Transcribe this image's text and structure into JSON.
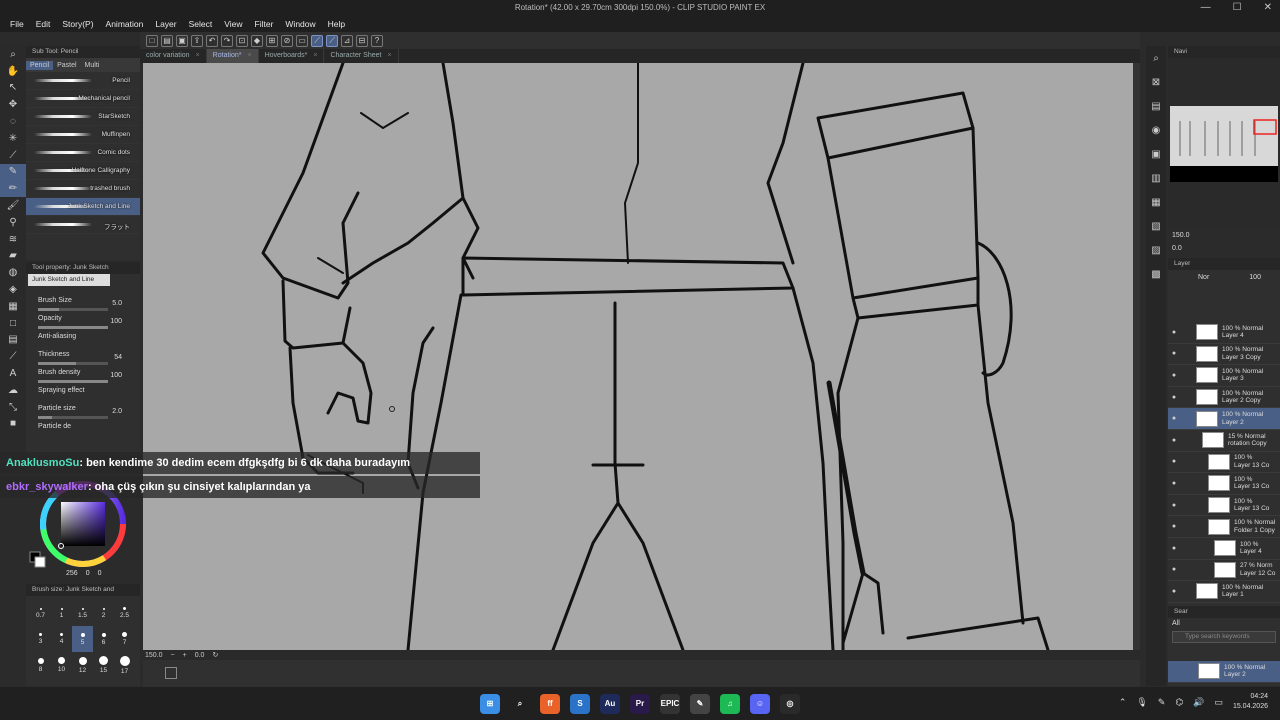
{
  "window": {
    "title": "Rotation* (42.00 x 29.70cm 300dpi 150.0%) - CLIP STUDIO PAINT EX",
    "controls": [
      "—",
      "☐",
      "✕"
    ]
  },
  "menu": [
    "File",
    "Edit",
    "Story(P)",
    "Animation",
    "Layer",
    "Select",
    "View",
    "Filter",
    "Window",
    "Help"
  ],
  "doc_tabs": [
    {
      "label": "color variation",
      "active": false
    },
    {
      "label": "Rotation*",
      "active": true
    },
    {
      "label": "Hoverboards*",
      "active": false
    },
    {
      "label": "Character Sheet",
      "active": false
    }
  ],
  "subtool": {
    "header": "Sub Tool: Pencil",
    "tabs": [
      "Pencil",
      "Pastel",
      "Multi"
    ],
    "brushes": [
      {
        "label": "Pencil",
        "selected": false
      },
      {
        "label": "Mechanical pencil",
        "selected": false
      },
      {
        "label": "StarSketch",
        "selected": false
      },
      {
        "label": "Muffinpen",
        "selected": false
      },
      {
        "label": "Comic dots",
        "selected": false
      },
      {
        "label": "Halftone Calligraphy",
        "selected": false
      },
      {
        "label": "trashed brush",
        "selected": false
      },
      {
        "label": "Junk Sketch and Line",
        "selected": true
      },
      {
        "label": "フラット",
        "selected": false
      }
    ]
  },
  "tool_property": {
    "header": "Tool property: Junk Sketch",
    "brush_name": "Junk Sketch and Line",
    "rows": [
      {
        "label": "Brush Size",
        "value": "5.0",
        "fill": 0.3
      },
      {
        "label": "Opacity",
        "value": "100",
        "fill": 1.0
      },
      {
        "label": "Anti-aliasing",
        "value": "",
        "fill": 0
      },
      {
        "label": "Thickness",
        "value": "54",
        "fill": 0.54
      },
      {
        "label": "Brush density",
        "value": "100",
        "fill": 1.0
      },
      {
        "label": "Spraying effect",
        "value": "",
        "fill": 0
      },
      {
        "label": "Particle size",
        "value": "2.0",
        "fill": 0.2
      },
      {
        "label": "Particle de",
        "value": "",
        "fill": 0
      }
    ]
  },
  "color": {
    "hsv_readout": "256",
    "v1": "0",
    "v2": "0"
  },
  "brush_size": {
    "header": "Brush size: Junk Sketch and",
    "sizes": [
      {
        "v": "0.7",
        "sel": false,
        "d": 2
      },
      {
        "v": "1",
        "sel": false,
        "d": 2
      },
      {
        "v": "1.5",
        "sel": false,
        "d": 2
      },
      {
        "v": "2",
        "sel": false,
        "d": 2
      },
      {
        "v": "2.5",
        "sel": false,
        "d": 3
      },
      {
        "v": "3",
        "sel": false,
        "d": 3
      },
      {
        "v": "4",
        "sel": false,
        "d": 3
      },
      {
        "v": "5",
        "sel": true,
        "d": 4
      },
      {
        "v": "6",
        "sel": false,
        "d": 4
      },
      {
        "v": "7",
        "sel": false,
        "d": 5
      },
      {
        "v": "8",
        "sel": false,
        "d": 6
      },
      {
        "v": "10",
        "sel": false,
        "d": 7
      },
      {
        "v": "12",
        "sel": false,
        "d": 8
      },
      {
        "v": "15",
        "sel": false,
        "d": 9
      },
      {
        "v": "17",
        "sel": false,
        "d": 10
      }
    ]
  },
  "chat": [
    {
      "user": "AnaklusmoSu",
      "user_color": "#4fe3c0",
      "message": ": ben kendime 30 dedim ecem dfgkşdfg bi 6 dk daha buradayım"
    },
    {
      "user": "ebkr_skywalker",
      "user_color": "#b06cff",
      "message": ": oha çüş çıkın şu cinsiyet kalıplarından ya"
    }
  ],
  "status": {
    "zoom": "150.0",
    "angle": "0.0"
  },
  "navigator": {
    "header": "Navi",
    "zoom": "150.0",
    "angle": "0.0"
  },
  "layers": {
    "header": "Layer",
    "blend_mode": "Nor",
    "opacity": "100",
    "rows": [
      {
        "line1": "100 % Normal",
        "line2": "Layer 4",
        "selected": false,
        "indent": 0
      },
      {
        "line1": "100 % Normal",
        "line2": "Layer 3 Copy",
        "selected": false,
        "indent": 0
      },
      {
        "line1": "100 % Normal",
        "line2": "Layer 3",
        "selected": false,
        "indent": 0
      },
      {
        "line1": "100 % Normal",
        "line2": "Layer 2 Copy",
        "selected": false,
        "indent": 0
      },
      {
        "line1": "100 % Normal",
        "line2": "Layer 2",
        "selected": true,
        "indent": 0
      },
      {
        "line1": "15 % Normal",
        "line2": "rotation Copy",
        "selected": false,
        "indent": 1
      },
      {
        "line1": "100 %",
        "line2": "Layer 13 Co",
        "selected": false,
        "indent": 2
      },
      {
        "line1": "100 %",
        "line2": "Layer 13 Co",
        "selected": false,
        "indent": 2
      },
      {
        "line1": "100 %",
        "line2": "Layer 13 Co",
        "selected": false,
        "indent": 2
      },
      {
        "line1": "100 % Normal",
        "line2": "Folder 1 Copy",
        "selected": false,
        "indent": 2
      },
      {
        "line1": "100 %",
        "line2": "Layer 4",
        "selected": false,
        "indent": 3
      },
      {
        "line1": "27 % Norm",
        "line2": "Layer 12 Co",
        "selected": false,
        "indent": 3
      },
      {
        "line1": "100 % Normal",
        "line2": "Layer 1",
        "selected": false,
        "indent": 0
      }
    ]
  },
  "search": {
    "header": "Sear",
    "placeholder": "Type search keywords",
    "filter": "All",
    "bottom_line1": "100 % Normal",
    "bottom_line2": "Layer 2"
  },
  "taskbar": {
    "apps": [
      {
        "icon": "windows-start-icon",
        "label": "⊞",
        "color": "#3a8ee6"
      },
      {
        "icon": "search-icon",
        "label": "⌕",
        "color": "#202020"
      },
      {
        "icon": "firefox-icon",
        "label": "ff",
        "color": "#e8622a"
      },
      {
        "icon": "storage-icon",
        "label": "S",
        "color": "#2a73c9"
      },
      {
        "icon": "audition-icon",
        "label": "Au",
        "color": "#1e2a5a"
      },
      {
        "icon": "premiere-icon",
        "label": "Pr",
        "color": "#2a1a4a"
      },
      {
        "icon": "epic-games-icon",
        "label": "EPIC",
        "color": "#333333"
      },
      {
        "icon": "clip-studio-icon",
        "label": "✎",
        "color": "#444444"
      },
      {
        "icon": "spotify-icon",
        "label": "♫",
        "color": "#1db954"
      },
      {
        "icon": "discord-icon",
        "label": "☺",
        "color": "#5865f2"
      },
      {
        "icon": "obs-icon",
        "label": "◎",
        "color": "#2a2a2a"
      }
    ],
    "time": "04:24",
    "date": "15.04.2026"
  }
}
